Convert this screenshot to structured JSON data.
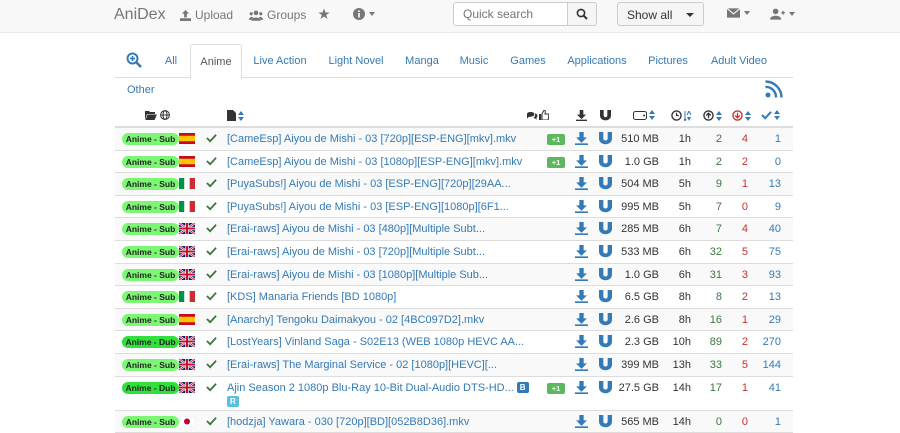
{
  "navbar": {
    "brand": "AniDex",
    "upload": "Upload",
    "groups": "Groups",
    "search_placeholder": "Quick search",
    "show_filter": "Show all"
  },
  "tabs": [
    "All",
    "Anime",
    "Live Action",
    "Light Novel",
    "Manga",
    "Music",
    "Games",
    "Applications",
    "Pictures",
    "Adult Video"
  ],
  "tab_other": "Other",
  "active_tab": "Anime",
  "colors": {
    "link": "#337ab7",
    "seeders": "#3c763d",
    "leechers": "#c9302c",
    "badge_sub": "#7cf774",
    "badge_dub": "#30e03b",
    "plus_badge": "#5cb85c"
  },
  "torrents": [
    {
      "category": "Anime - Sub",
      "lang": "es",
      "title": "[CameEsp] Aiyou de Mishi - 03 [720p][ESP-ENG][mkv].mkv",
      "comments": "+1",
      "size": "510 MB",
      "age": "1h",
      "seeders": "2",
      "leechers": "4",
      "completed": "1"
    },
    {
      "category": "Anime - Sub",
      "lang": "es",
      "title": "[CameEsp] Aiyou de Mishi - 03 [1080p][ESP-ENG][mkv].mkv",
      "comments": "+1",
      "size": "1.0 GB",
      "age": "1h",
      "seeders": "2",
      "leechers": "2",
      "completed": "0"
    },
    {
      "category": "Anime - Sub",
      "lang": "it",
      "title": "[PuyaSubs!] Aiyou de Mishi - 03 [ESP-ENG][720p][29AA...",
      "comments": "",
      "size": "504 MB",
      "age": "5h",
      "seeders": "9",
      "leechers": "1",
      "completed": "13"
    },
    {
      "category": "Anime - Sub",
      "lang": "it",
      "title": "[PuyaSubs!] Aiyou de Mishi - 03 [ESP-ENG][1080p][6F1...",
      "comments": "",
      "size": "995 MB",
      "age": "5h",
      "seeders": "7",
      "leechers": "0",
      "completed": "9"
    },
    {
      "category": "Anime - Sub",
      "lang": "gb",
      "title": "[Erai-raws] Aiyou de Mishi - 03 [480p][Multiple Subt...",
      "comments": "",
      "size": "285 MB",
      "age": "6h",
      "seeders": "7",
      "leechers": "4",
      "completed": "40"
    },
    {
      "category": "Anime - Sub",
      "lang": "gb",
      "title": "[Erai-raws] Aiyou de Mishi - 03 [720p][Multiple Subt...",
      "comments": "",
      "size": "533 MB",
      "age": "6h",
      "seeders": "32",
      "leechers": "5",
      "completed": "75"
    },
    {
      "category": "Anime - Sub",
      "lang": "gb",
      "title": "[Erai-raws] Aiyou de Mishi - 03 [1080p][Multiple Sub...",
      "comments": "",
      "size": "1.0 GB",
      "age": "6h",
      "seeders": "31",
      "leechers": "3",
      "completed": "93"
    },
    {
      "category": "Anime - Sub",
      "lang": "it",
      "title": "[KDS] Manaria Friends [BD 1080p]",
      "comments": "",
      "size": "6.5 GB",
      "age": "8h",
      "seeders": "8",
      "leechers": "2",
      "completed": "13"
    },
    {
      "category": "Anime - Sub",
      "lang": "es",
      "title": "[Anarchy] Tengoku Daimakyou - 02 [4BC097D2].mkv",
      "comments": "",
      "size": "2.6 GB",
      "age": "8h",
      "seeders": "16",
      "leechers": "1",
      "completed": "29"
    },
    {
      "category": "Anime - Dub",
      "lang": "gb",
      "title": "[LostYears] Vinland Saga - S02E13 (WEB 1080p HEVC AA...",
      "comments": "",
      "size": "2.3 GB",
      "age": "10h",
      "seeders": "89",
      "leechers": "2",
      "completed": "270"
    },
    {
      "category": "Anime - Sub",
      "lang": "gb",
      "title": "[Erai-raws] The Marginal Service - 02 [1080p][HEVC][...",
      "comments": "",
      "size": "399 MB",
      "age": "13h",
      "seeders": "33",
      "leechers": "5",
      "completed": "144"
    },
    {
      "category": "Anime - Dub",
      "lang": "gb",
      "title": "Ajin Season 2 1080p Blu-Ray 10-Bit Dual-Audio DTS-HD...",
      "tags": [
        "B",
        "R"
      ],
      "comments": "+1",
      "size": "27.5 GB",
      "age": "14h",
      "seeders": "17",
      "leechers": "1",
      "completed": "41"
    },
    {
      "category": "Anime - Sub",
      "lang": "jp",
      "title": "[hodzja] Yawara - 030 [720p][BD][052B8D36].mkv",
      "comments": "",
      "size": "565 MB",
      "age": "14h",
      "seeders": "0",
      "leechers": "0",
      "completed": "1"
    }
  ]
}
